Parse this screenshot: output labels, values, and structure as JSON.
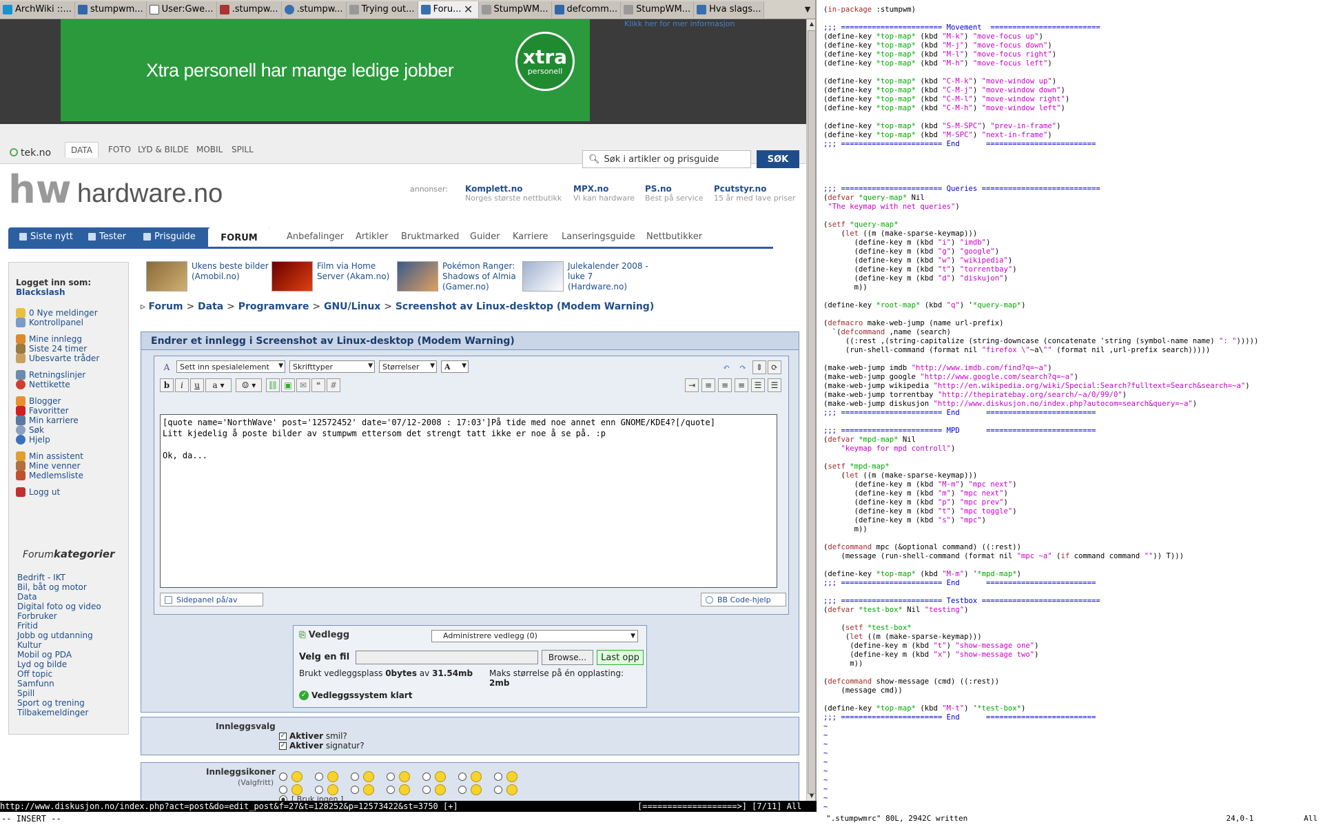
{
  "tabs": [
    {
      "label": "ArchWiki ::..."
    },
    {
      "label": "stumpwm..."
    },
    {
      "label": "User:Gwe..."
    },
    {
      "label": ".stumpw..."
    },
    {
      "label": ".stumpw..."
    },
    {
      "label": "Trying out..."
    },
    {
      "label": "Foru..."
    },
    {
      "label": "StumpWM..."
    },
    {
      "label": "defcomm..."
    },
    {
      "label": "StumpWM..."
    },
    {
      "label": "Hva slags..."
    }
  ],
  "ad": {
    "text": "Xtra personell har mange ledige jobber",
    "logo_top": "xtra",
    "logo_bottom": "personell",
    "info": "Klikk her for mer informasjon"
  },
  "topnav": {
    "brand": "tek.no",
    "items": [
      "DATA",
      "FOTO",
      "LYD & BILDE",
      "MOBIL",
      "SPILL"
    ],
    "search_placeholder": "Søk i artikler og prisguide",
    "search_button": "SØK"
  },
  "site": {
    "logo_text": "hardware.no",
    "annonser_label": "annonser:",
    "ads": [
      {
        "name": "Komplett.no",
        "sub": "Norges største nettbutikk"
      },
      {
        "name": "MPX.no",
        "sub": "Vi kan hardware"
      },
      {
        "name": "PS.no",
        "sub": "Best på service"
      },
      {
        "name": "Pcutstyr.no",
        "sub": "15 år med lave priser"
      }
    ]
  },
  "mainnav": {
    "blue": [
      "Siste nytt",
      "Tester",
      "Prisguide"
    ],
    "forum": "FORUM",
    "right": [
      "Anbefalinger",
      "Artikler",
      "Bruktmarked",
      "Guider",
      "Karriere",
      "Lanseringsguide",
      "Nettbutikker"
    ]
  },
  "sidebar": {
    "logged_in_label": "Logget inn som:",
    "username": "Blackslash",
    "links": [
      "0 Nye meldinger",
      "Kontrollpanel",
      "Mine innlegg",
      "Siste 24 timer",
      "Ubesvarte tråder",
      "Retningslinjer",
      "Nettikette",
      "Blogger",
      "Favoritter",
      "Min karriere",
      "Søk",
      "Hjelp",
      "Min assistent",
      "Mine venner",
      "Medlemsliste",
      "Logg ut"
    ],
    "forumkat_a": "Forum",
    "forumkat_b": "kategorier",
    "categories": [
      "Bedrift - IKT",
      "Bil, båt og motor",
      "Data",
      "Digital foto og video",
      "Forbruker",
      "Fritid",
      "Jobb og utdanning",
      "Kultur",
      "Mobil og PDA",
      "Lyd og bilde",
      "Off topic",
      "Samfunn",
      "Spill",
      "Sport og trening",
      "Tilbakemeldinger"
    ]
  },
  "featured": [
    {
      "line1": "Ukens beste bilder",
      "line2": "(Amobil.no)"
    },
    {
      "line1": "Film via Home",
      "line2": "Server (Akam.no)"
    },
    {
      "line1": "Pokémon Ranger:",
      "line2": "Shadows of Almia",
      "line3": "(Gamer.no)"
    },
    {
      "line1": "Julekalender 2008 -",
      "line2": "luke 7",
      "line3": "(Hardware.no)"
    }
  ],
  "breadcrumb": [
    "Forum",
    "Data",
    "Programvare",
    "GNU/Linux",
    "Screenshot av Linux-desktop (Modem Warning)"
  ],
  "editor": {
    "title": "Endrer et innlegg i Screenshot av Linux-desktop (Modem Warning)",
    "select_special": "Sett inn spesialelement",
    "select_font": "Skrifttyper",
    "select_size": "Størrelser",
    "text": "[quote name='NorthWave' post='12572452' date='07/12-2008 : 17:03']På tide med noe annet enn GNOME/KDE4?[/quote]\nLitt kjedelig å poste bilder av stumpwm ettersom det strengt tatt ikke er noe å se på. :p\n\nOk, da...",
    "sidepanel": "Sidepanel på/av",
    "bbhelp": "BB Code-hjelp"
  },
  "vedlegg": {
    "title": "Vedlegg",
    "select": "Administrere vedlegg (0)",
    "velg": "Velg en fil",
    "browse": "Browse...",
    "upload": "Last opp",
    "used_label": "Brukt vedleggsplass",
    "used_value": "0bytes",
    "used_of": "av",
    "used_total": "31.54mb",
    "max_label": "Maks størrelse på én opplasting:",
    "max_value": "2mb",
    "ready": "Vedleggssystem klart"
  },
  "innleggsvalg": {
    "label": "Innleggsvalg",
    "opt1_b": "Aktiver",
    "opt1": "smil?",
    "opt2_b": "Aktiver",
    "opt2": "signatur?"
  },
  "innleggsikoner": {
    "label": "Innleggsikoner",
    "sub": "(Valgfritt)",
    "none": "[ Bruk ingen ]"
  },
  "statusbar": "http://www.diskusjon.no/index.php?act=post&do=edit_post&f=27&t=128252&p=12573422&st=3750 [+]",
  "progress": {
    "value": 0.64,
    "text": "[===================>] [7/11] All"
  },
  "modebar": "-- INSERT --",
  "vim": {
    "lines": [
      "(in-package :stumpwm)",
      "",
      ";;; ======================= Movement  =========================",
      "(define-key *top-map* (kbd \"M-k\") \"move-focus up\")",
      "(define-key *top-map* (kbd \"M-j\") \"move-focus down\")",
      "(define-key *top-map* (kbd \"M-l\") \"move-focus right\")",
      "(define-key *top-map* (kbd \"M-h\") \"move-focus left\")",
      "",
      "(define-key *top-map* (kbd \"C-M-k\") \"move-window up\")",
      "(define-key *top-map* (kbd \"C-M-j\") \"move-window down\")",
      "(define-key *top-map* (kbd \"C-M-l\") \"move-window right\")",
      "(define-key *top-map* (kbd \"C-M-h\") \"move-window left\")",
      "",
      "(define-key *top-map* (kbd \"S-M-SPC\") \"prev-in-frame\")",
      "(define-key *top-map* (kbd \"M-SPC\") \"next-in-frame\")",
      ";;; ======================= End      =========================",
      "",
      "",
      "",
      "",
      ";;; ======================= Queries ===========================",
      "(defvar *query-map* Nil",
      " \"The keymap with net queries\")",
      "",
      "(setf *query-map*",
      "    (let ((m (make-sparse-keymap)))",
      "       (define-key m (kbd \"i\") \"imdb\")",
      "       (define-key m (kbd \"g\") \"google\")",
      "       (define-key m (kbd \"w\") \"wikipedia\")",
      "       (define-key m (kbd \"t\") \"torrentbay\")",
      "       (define-key m (kbd \"d\") \"diskujon\")",
      "       m))",
      "",
      "(define-key *root-map* (kbd \"q\") '*query-map*)",
      "",
      "(defmacro make-web-jump (name url-prefix)",
      "  `(defcommand ,name (search)",
      "     ((:rest ,(string-capitalize (string-downcase (concatenate 'string (symbol-name name) \": \")))))",
      "     (run-shell-command (format nil \"firefox \\\"~a\\\"\" (format nil ,url-prefix search)))))",
      "",
      "(make-web-jump imdb \"http://www.imdb.com/find?q=~a\")",
      "(make-web-jump google \"http://www.google.com/search?q=~a\")",
      "(make-web-jump wikipedia \"http://en.wikipedia.org/wiki/Special:Search?fulltext=Search&search=~a\")",
      "(make-web-jump torrentbay \"http://thepiratebay.org/search/~a/0/99/0\")",
      "(make-web-jump diskusjon \"http://www.diskusjon.no/index.php?autocom=search&query=~a\")",
      ";;; ======================= End      =========================",
      "",
      ";;; ======================= MPD      =========================",
      "(defvar *mpd-map* Nil",
      "    \"keymap for mpd controll\")",
      "",
      "(setf *mpd-map*",
      "    (let ((m (make-sparse-keymap)))",
      "       (define-key m (kbd \"M-m\") \"mpc next\")",
      "       (define-key m (kbd \"m\") \"mpc next\")",
      "       (define-key m (kbd \"p\") \"mpc prev\")",
      "       (define-key m (kbd \"t\") \"mpc toggle\")",
      "       (define-key m (kbd \"s\") \"mpc\")",
      "       m))",
      "",
      "(defcommand mpc (&optional command) ((:rest))",
      "    (message (run-shell-command (format nil \"mpc ~a\" (if command command \"\")) T)))",
      "",
      "(define-key *top-map* (kbd \"M-m\") '*mpd-map*)",
      ";;; ======================= End      =========================",
      "",
      ";;; ======================= Testbox ===========================",
      "(defvar *test-box* Nil \"testing\")",
      "",
      "    (setf *test-box*",
      "     (let ((m (make-sparse-keymap)))",
      "      (define-key m (kbd \"t\") \"show-message one\")",
      "      (define-key m (kbd \"x\") \"show-message two\")",
      "      m))",
      "",
      "(defcommand show-message (cmd) ((:rest))",
      "    (message cmd))",
      "",
      "(define-key *top-map* (kbd \"M-t\") '*test-box*)",
      ";;; ======================= End      =========================",
      "~",
      "~",
      "~",
      "~",
      "~",
      "~",
      "~",
      "~",
      "~",
      "~"
    ],
    "status": "\".stumpwmrc\" 80L, 2942C written",
    "position": "24,0-1",
    "scroll": "All"
  }
}
